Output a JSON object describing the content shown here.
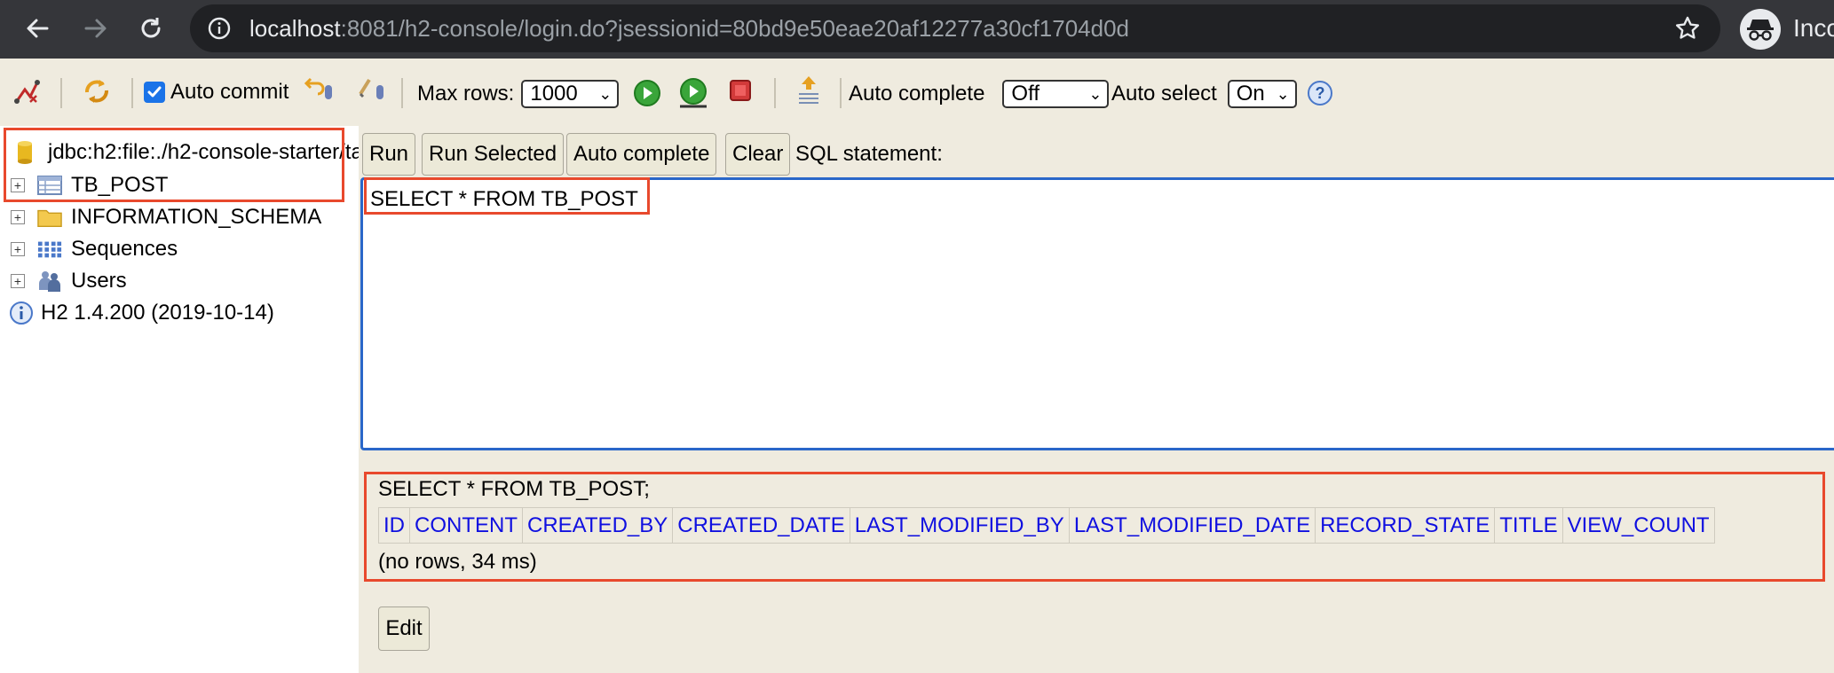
{
  "browser": {
    "url_host": "localhost",
    "url_rest": ":8081/h2-console/login.do?jsessionid=80bd9e50eae20af12277a30cf1704d0d",
    "profile_label": "Inco"
  },
  "toolbar": {
    "auto_commit_label": "Auto commit",
    "auto_commit_checked": true,
    "max_rows_label": "Max rows:",
    "max_rows_value": "1000",
    "auto_complete_label": "Auto complete",
    "auto_complete_value": "Off",
    "auto_select_label": "Auto select",
    "auto_select_value": "On",
    "help_icon": "help-icon"
  },
  "tree": {
    "connection": "jdbc:h2:file:./h2-console-starter/ta",
    "items": [
      {
        "label": "TB_POST",
        "icon": "table-icon"
      },
      {
        "label": "INFORMATION_SCHEMA",
        "icon": "folder-icon"
      },
      {
        "label": "Sequences",
        "icon": "sequence-icon"
      },
      {
        "label": "Users",
        "icon": "users-icon"
      }
    ],
    "version": "H2 1.4.200 (2019-10-14)"
  },
  "query": {
    "buttons": {
      "run": "Run",
      "run_selected": "Run Selected",
      "auto_complete": "Auto complete",
      "clear": "Clear"
    },
    "sql_label": "SQL statement:",
    "editor_text": "SELECT * FROM TB_POST"
  },
  "result": {
    "sql": "SELECT * FROM TB_POST;",
    "columns": [
      "ID",
      "CONTENT",
      "CREATED_BY",
      "CREATED_DATE",
      "LAST_MODIFIED_BY",
      "LAST_MODIFIED_DATE",
      "RECORD_STATE",
      "TITLE",
      "VIEW_COUNT"
    ],
    "status": "(no rows, 34 ms)",
    "edit_label": "Edit"
  },
  "colors": {
    "highlight": "#e8492d",
    "panel_bg": "#efebdf",
    "column_link": "#1010e0",
    "editor_border": "#2a67c9"
  }
}
